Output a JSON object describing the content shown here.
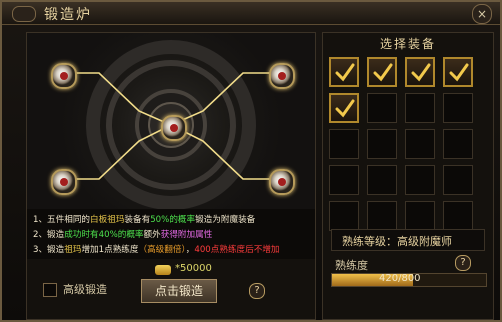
{
  "window": {
    "title": "锻造炉"
  },
  "forge": {
    "info_lines": [
      {
        "parts": [
          {
            "text": "1、五件相同的",
            "color": "white"
          },
          {
            "text": "白板祖玛",
            "color": "yellow"
          },
          {
            "text": "装备有",
            "color": "white"
          },
          {
            "text": "50%的概率",
            "color": "green"
          },
          {
            "text": "锻造为附魔装备",
            "color": "white"
          }
        ]
      },
      {
        "parts": [
          {
            "text": "2、锻造",
            "color": "white"
          },
          {
            "text": "成功时有",
            "color": "green"
          },
          {
            "text": "40%的概率",
            "color": "green"
          },
          {
            "text": "额外",
            "color": "white"
          },
          {
            "text": "获得附加属性",
            "color": "pink"
          }
        ]
      },
      {
        "parts": [
          {
            "text": "3、锻造",
            "color": "white"
          },
          {
            "text": "祖玛",
            "color": "yellow"
          },
          {
            "text": "增加1点熟练度",
            "color": "white"
          },
          {
            "text": "（高级翻倍）",
            "color": "orange"
          },
          {
            "text": "，",
            "color": "white"
          },
          {
            "text": "400点熟练度后不增加",
            "color": "red"
          }
        ]
      }
    ],
    "gold_cost": "*50000",
    "advanced_checkbox_label": "高级锻造",
    "advanced_checked": false,
    "forge_button_label": "点击锻造"
  },
  "equipment": {
    "title": "选择装备",
    "cells": [
      {
        "selected": true
      },
      {
        "selected": true
      },
      {
        "selected": true
      },
      {
        "selected": true
      },
      {
        "selected": true
      },
      {
        "selected": false
      },
      {
        "selected": false
      },
      {
        "selected": false
      },
      {
        "selected": false
      },
      {
        "selected": false
      },
      {
        "selected": false
      },
      {
        "selected": false
      },
      {
        "selected": false
      },
      {
        "selected": false
      },
      {
        "selected": false
      },
      {
        "selected": false
      },
      {
        "selected": false
      },
      {
        "selected": false
      },
      {
        "selected": false
      },
      {
        "selected": false
      }
    ]
  },
  "skill": {
    "level_text": "熟练等级：高级附魔师"
  },
  "proficiency": {
    "label": "熟练度",
    "current": 420,
    "max": 800,
    "text": "420/800"
  },
  "help_symbol": "?",
  "close_symbol": "×",
  "colors": {
    "accent": "#b0882c",
    "gold": "#e2c24a",
    "green": "#4de04d",
    "pink": "#e46ae4",
    "red": "#ff3c3c"
  }
}
